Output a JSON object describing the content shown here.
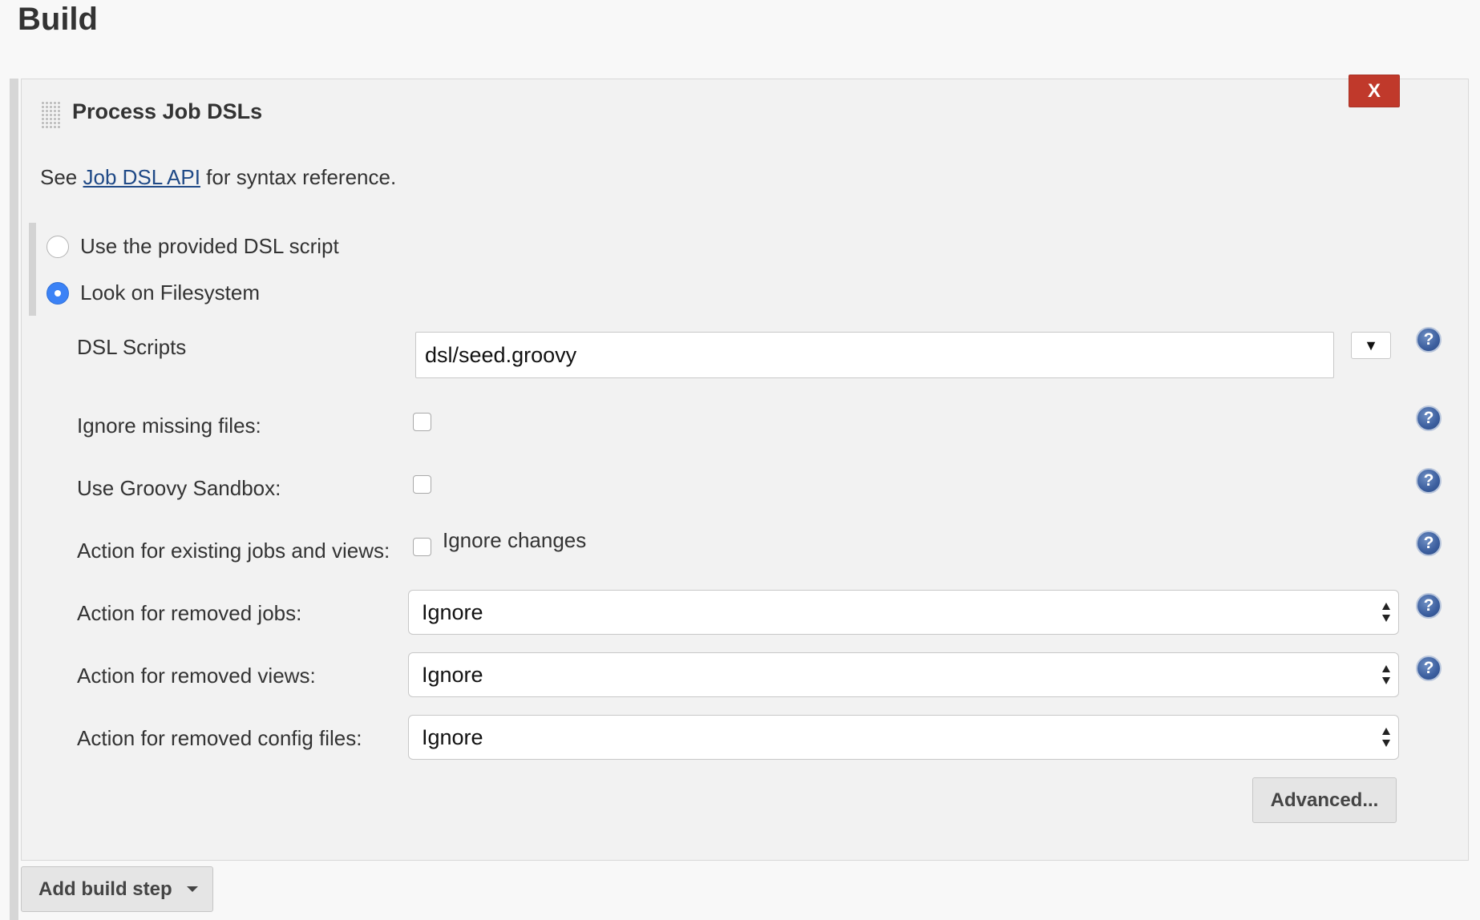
{
  "page": {
    "title": "Build"
  },
  "build_step": {
    "title": "Process Job DSLs",
    "delete_label": "X",
    "help_prefix": "See ",
    "help_link": "Job DSL API",
    "help_suffix": " for syntax reference.",
    "source_options": [
      {
        "label": "Use the provided DSL script",
        "checked": false
      },
      {
        "label": "Look on Filesystem",
        "checked": true
      }
    ],
    "fields": {
      "dsl_scripts": {
        "label": "DSL Scripts",
        "value": "dsl/seed.groovy",
        "expand_icon": "▼"
      },
      "ignore_missing": {
        "label": "Ignore missing files:",
        "checked": false
      },
      "groovy_sandbox": {
        "label": "Use Groovy Sandbox:",
        "checked": false
      },
      "existing_action": {
        "label": "Action for existing jobs and views:",
        "option_label": "Ignore changes",
        "checked": false
      },
      "removed_jobs": {
        "label": "Action for removed jobs:",
        "value": "Ignore"
      },
      "removed_views": {
        "label": "Action for removed views:",
        "value": "Ignore"
      },
      "removed_config": {
        "label": "Action for removed config files:",
        "value": "Ignore"
      }
    },
    "help_icon_glyph": "?",
    "advanced_label": "Advanced..."
  },
  "footer": {
    "add_step_label": "Add build step"
  },
  "colors": {
    "accent": "#3b82f6",
    "delete": "#c0392b",
    "link": "#204a87"
  }
}
